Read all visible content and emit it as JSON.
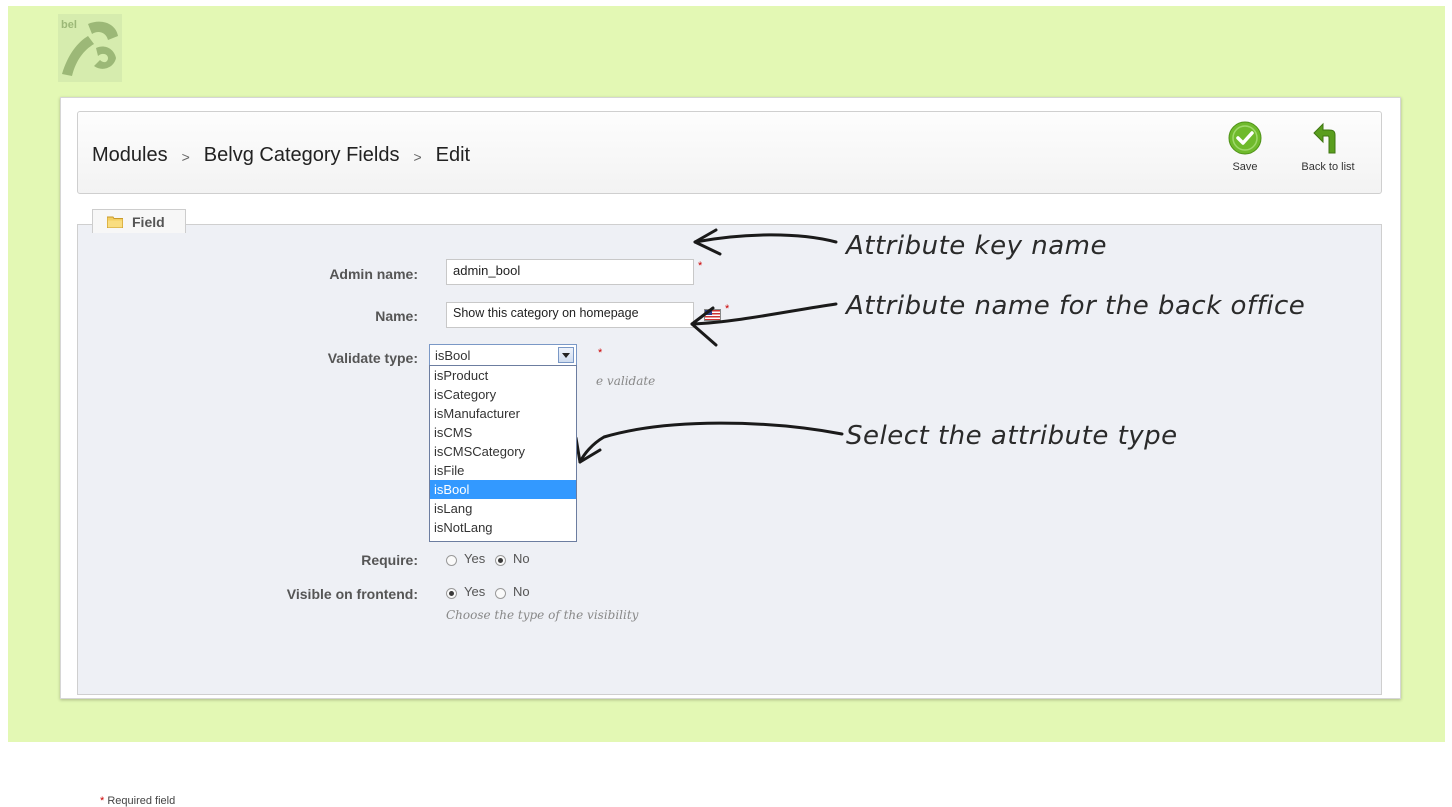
{
  "breadcrumb": {
    "items": [
      "Modules",
      "Belvg Category Fields",
      "Edit"
    ],
    "separator": ">"
  },
  "toolbar": {
    "save_label": "Save",
    "back_label": "Back to list"
  },
  "fieldset": {
    "legend": "Field"
  },
  "form": {
    "admin_name": {
      "label": "Admin name:",
      "value": "admin_bool"
    },
    "name": {
      "label": "Name:",
      "value": "Show this category on homepage"
    },
    "validate_type": {
      "label": "Validate type:",
      "selected": "isBool",
      "hint_visible": "e validate",
      "options": [
        "isProduct",
        "isCategory",
        "isManufacturer",
        "isCMS",
        "isCMSCategory",
        "isFile",
        "isBool",
        "isLang",
        "isNotLang"
      ]
    },
    "require": {
      "label": "Require:",
      "yes": "Yes",
      "no": "No",
      "selected": "No"
    },
    "visible_on_frontend": {
      "label": "Visible on frontend:",
      "yes": "Yes",
      "no": "No",
      "selected": "Yes",
      "hint": "Choose the type of the visibility"
    },
    "required_note": "Required field",
    "required_mark": "*"
  },
  "annotations": {
    "key_name": "Attribute key name",
    "back_office": "Attribute name for the back office",
    "select_type": "Select the attribute type"
  },
  "colors": {
    "page_background": "#e3f8b4",
    "form_background": "#eef0f5",
    "selected_option": "#3399ff",
    "save_icon": "#6fba2c",
    "back_icon": "#5a9e1e",
    "required": "#cc0000"
  },
  "icons": [
    "logo-icon",
    "save-icon",
    "back-arrow-icon",
    "folder-icon",
    "us-flag-icon",
    "chevron-down-icon"
  ]
}
